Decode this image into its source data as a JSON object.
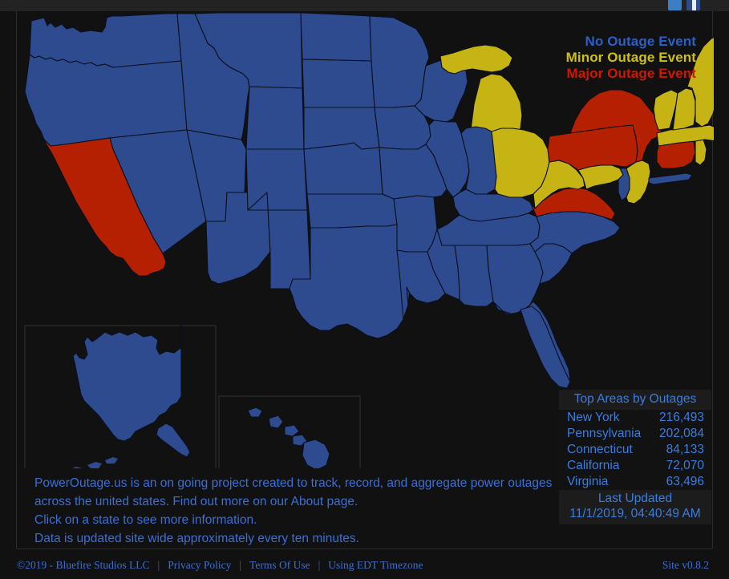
{
  "topbar": {
    "social": [
      {
        "name": "twitter-icon",
        "label": "Twitter"
      },
      {
        "name": "facebook-icon",
        "label": "Facebook"
      }
    ]
  },
  "legend": {
    "none": "No Outage Event",
    "minor": "Minor Outage Event",
    "major": "Major Outage Event",
    "color_none": "#2c5fc9",
    "color_minor": "#cfc20e",
    "color_major": "#cf1800"
  },
  "map": {
    "fill_none": "#2e4b8f",
    "fill_minor": "#c5b414",
    "fill_major": "#b52000",
    "stroke": "#0b0f1c",
    "background": "#111111",
    "states_major": [
      "California",
      "New York",
      "Pennsylvania",
      "Connecticut",
      "Virginia"
    ],
    "states_minor": [
      "Michigan",
      "Ohio",
      "West Virginia",
      "Maryland",
      "Delaware",
      "New Jersey",
      "Vermont",
      "New Hampshire",
      "Maine",
      "Massachusetts",
      "Rhode Island"
    ],
    "insets": [
      "Alaska",
      "Hawaii"
    ]
  },
  "top_areas": {
    "title": "Top Areas by Outages",
    "rows": [
      {
        "name": "New York",
        "value": "216,493"
      },
      {
        "name": "Pennsylvania",
        "value": "202,084"
      },
      {
        "name": "Connecticut",
        "value": "84,133"
      },
      {
        "name": "California",
        "value": "72,070"
      },
      {
        "name": "Virginia",
        "value": "63,496"
      }
    ],
    "last_updated_label": "Last Updated",
    "last_updated_value": "11/1/2019, 04:40:49 AM"
  },
  "description": {
    "line1": "PowerOutage.us is an on going project created to track, record, and aggregate power outages",
    "line2": "across the united states. Find out more on our About page.",
    "line3": "Click on a state to see more information.",
    "line4": "Data is updated site wide approximately every ten minutes."
  },
  "footer": {
    "copyright": "©2019 - Bluefire Studios LLC",
    "sep": "|",
    "privacy": "Privacy Policy",
    "terms": "Terms Of Use",
    "timezone": "Using EDT Timezone",
    "version": "Site v0.8.2"
  }
}
